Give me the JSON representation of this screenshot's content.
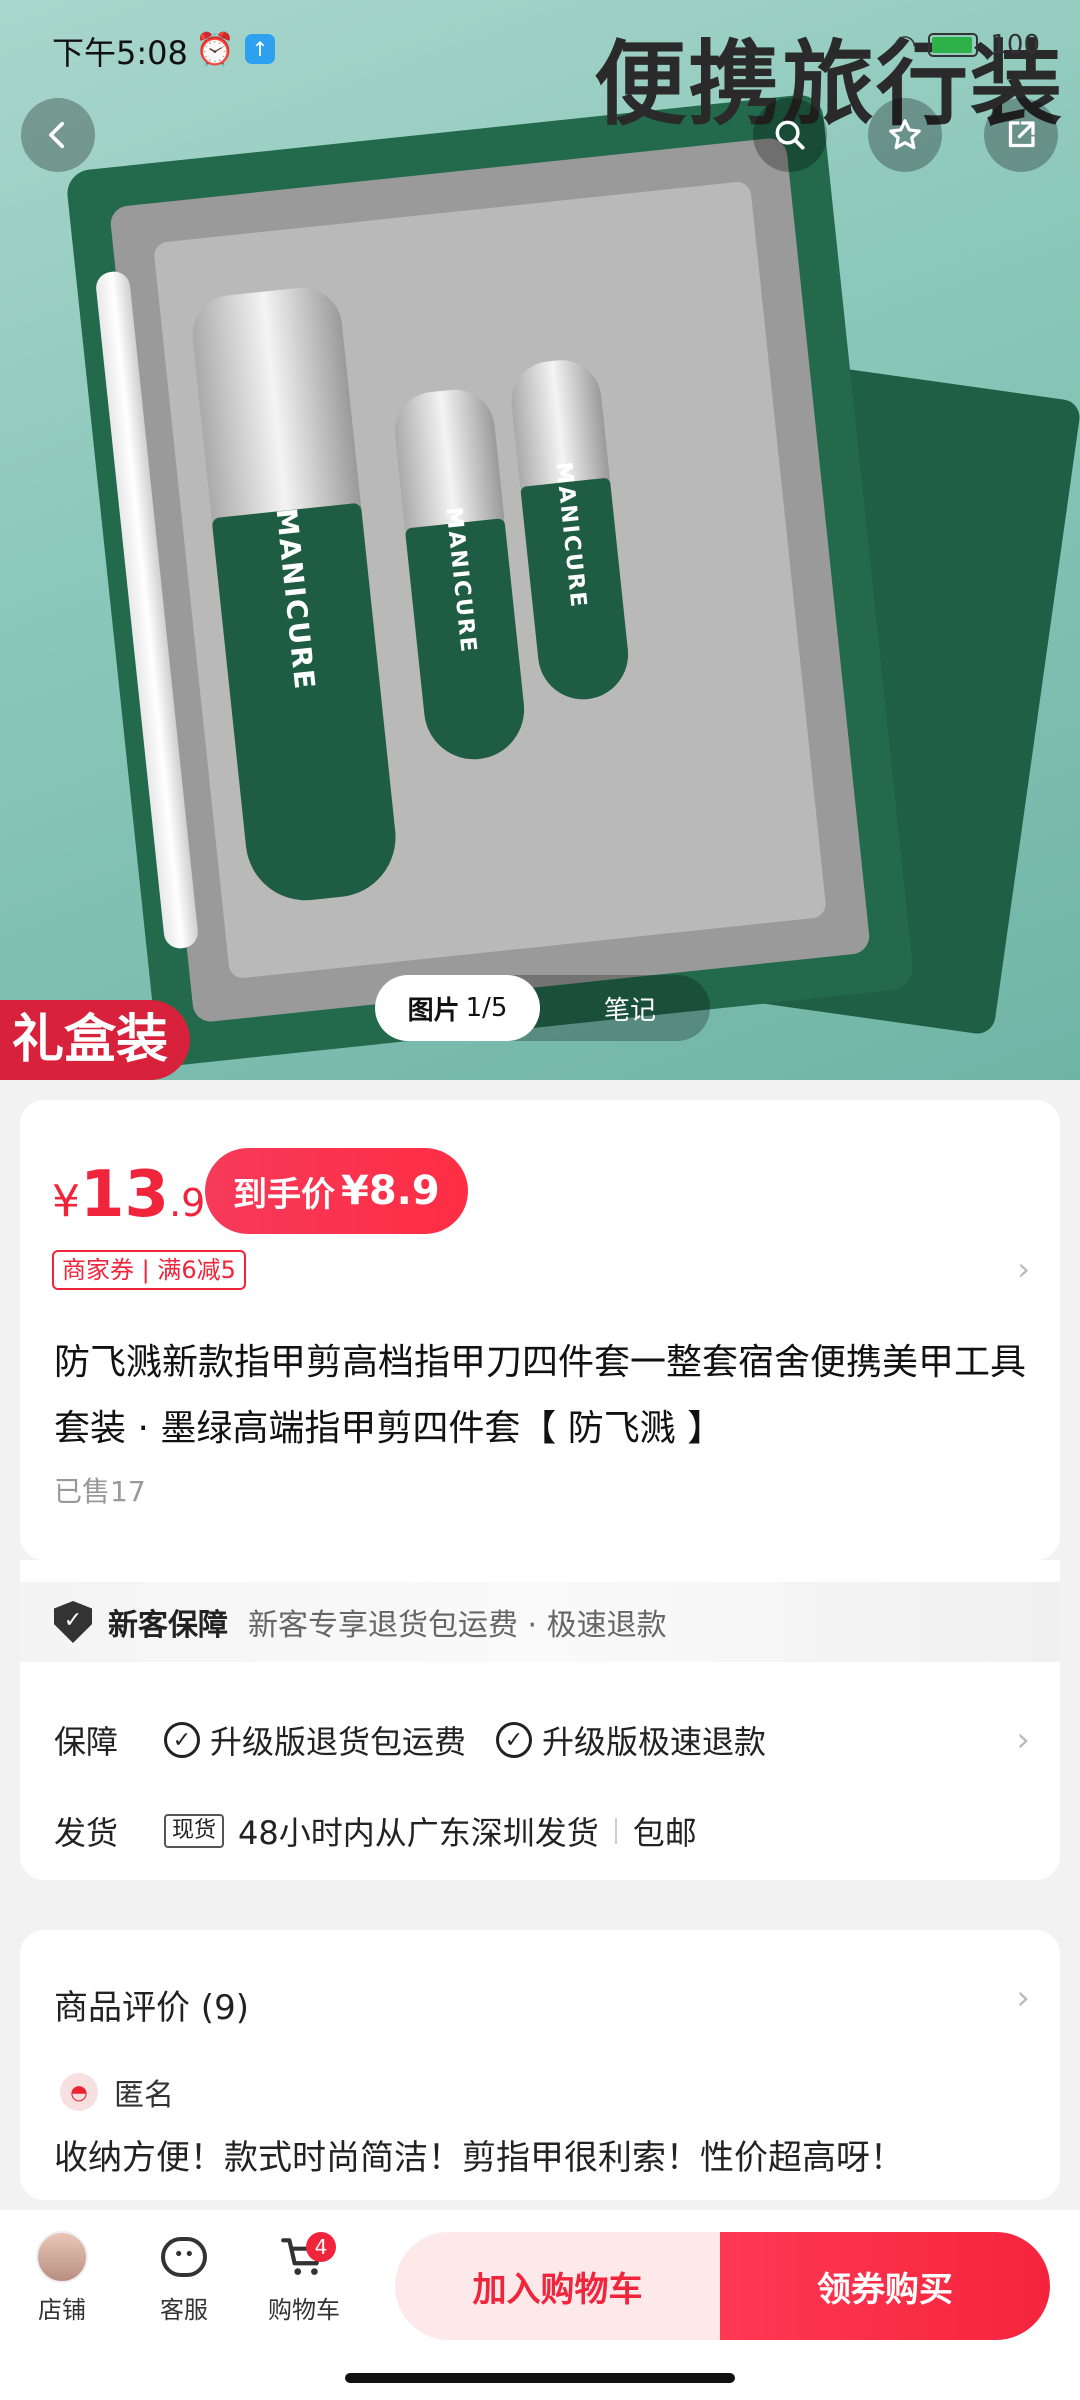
{
  "status_bar": {
    "time": "下午5:08",
    "alarm_icon": "alarm-icon",
    "battery": "100"
  },
  "nav": {
    "back_icon": "chevron-left-icon",
    "search_icon": "search-icon",
    "favorite_icon": "star-icon",
    "share_icon": "share-icon"
  },
  "hero": {
    "banner_text": "便携旅行装",
    "brand_text": "MANICURE",
    "gift_tag": "礼盒装",
    "media_tab_active": "图片",
    "media_count": "1/5",
    "media_tab_other": "笔记"
  },
  "price": {
    "currency": "¥",
    "integer": "13",
    "decimal": ".9",
    "final_label": "到手价",
    "final_amount": "¥8.9",
    "coupon": "商家券 | 满6减5"
  },
  "product": {
    "title": "防飞溅新款指甲剪高档指甲刀四件套一整套宿舍便携美甲工具套装 · 墨绿高端指甲剪四件套【 防飞溅 】",
    "sold": "已售17"
  },
  "services": {
    "newbie_title": "新客保障",
    "newbie_desc": "新客专享退货包运费 · 极速退款",
    "guarantee_label": "保障",
    "guarantee_items": [
      "升级版退货包运费",
      "升级版极速退款"
    ],
    "shipping_label": "发货",
    "shipping_tag": "现货",
    "shipping_desc": "48小时内从广东深圳发货",
    "shipping_free": "包邮"
  },
  "review": {
    "heading": "商品评价 (9)",
    "user": "匿名",
    "text": "收纳方便！款式时尚简洁！剪指甲很利索！性价超高呀！"
  },
  "bottom_bar": {
    "shop_label": "店铺",
    "service_label": "客服",
    "cart_label": "购物车",
    "cart_count": "4",
    "add_cart": "加入购物车",
    "buy": "领券购买"
  },
  "colors": {
    "accent": "#f0243b",
    "product_green": "#1e5c43"
  }
}
